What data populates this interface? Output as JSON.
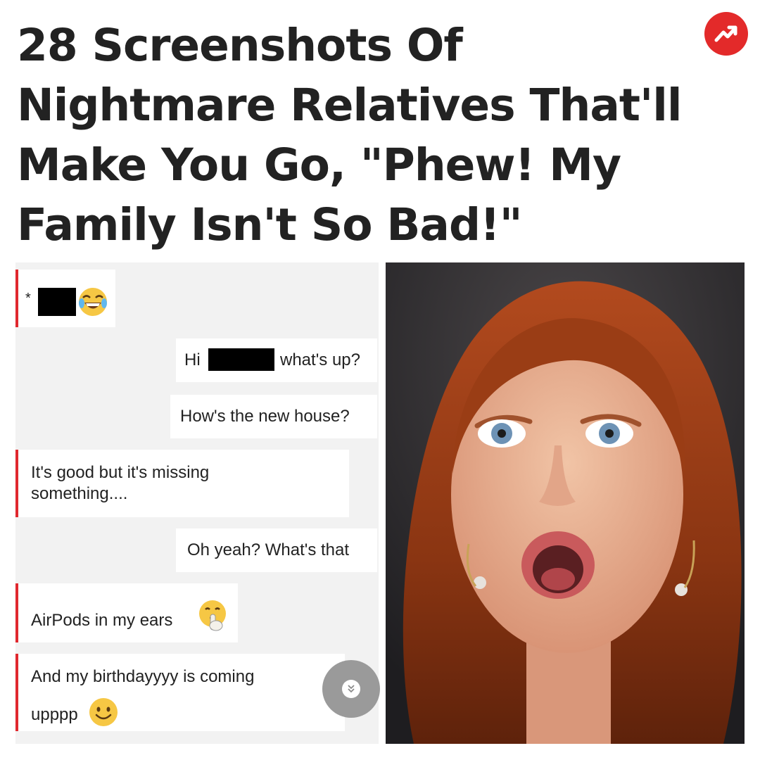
{
  "headline": {
    "lines": [
      "28 Screenshots Of",
      "Nightmare Relatives That'll",
      "Make You Go, \"Phew! My",
      "Family Isn't So Bad!\""
    ]
  },
  "badge": {
    "icon": "trending-arrow-icon",
    "color": "#e32a2a"
  },
  "chat": {
    "accent_color": "#e0282e",
    "messages": [
      {
        "side": "incoming",
        "prefix": "*",
        "emoji": "joy-emoji"
      },
      {
        "side": "outgoing",
        "before": "Hi",
        "after": "what's up?"
      },
      {
        "side": "outgoing",
        "text": "How's the new house?"
      },
      {
        "side": "incoming",
        "line1": "It's good but it's missing",
        "line2": "something...."
      },
      {
        "side": "outgoing",
        "text": "Oh yeah? What's that"
      },
      {
        "side": "incoming",
        "text": "AirPods in my ears",
        "emoji": "shushing-face-emoji"
      },
      {
        "side": "incoming",
        "line1": "And my birthdayyyy is coming",
        "line2": "upppp",
        "emoji": "smiling-face-emoji"
      }
    ],
    "scroll_button_icon": "chevron-double-down-icon"
  },
  "photo": {
    "subject": "shocked-woman-photo"
  }
}
